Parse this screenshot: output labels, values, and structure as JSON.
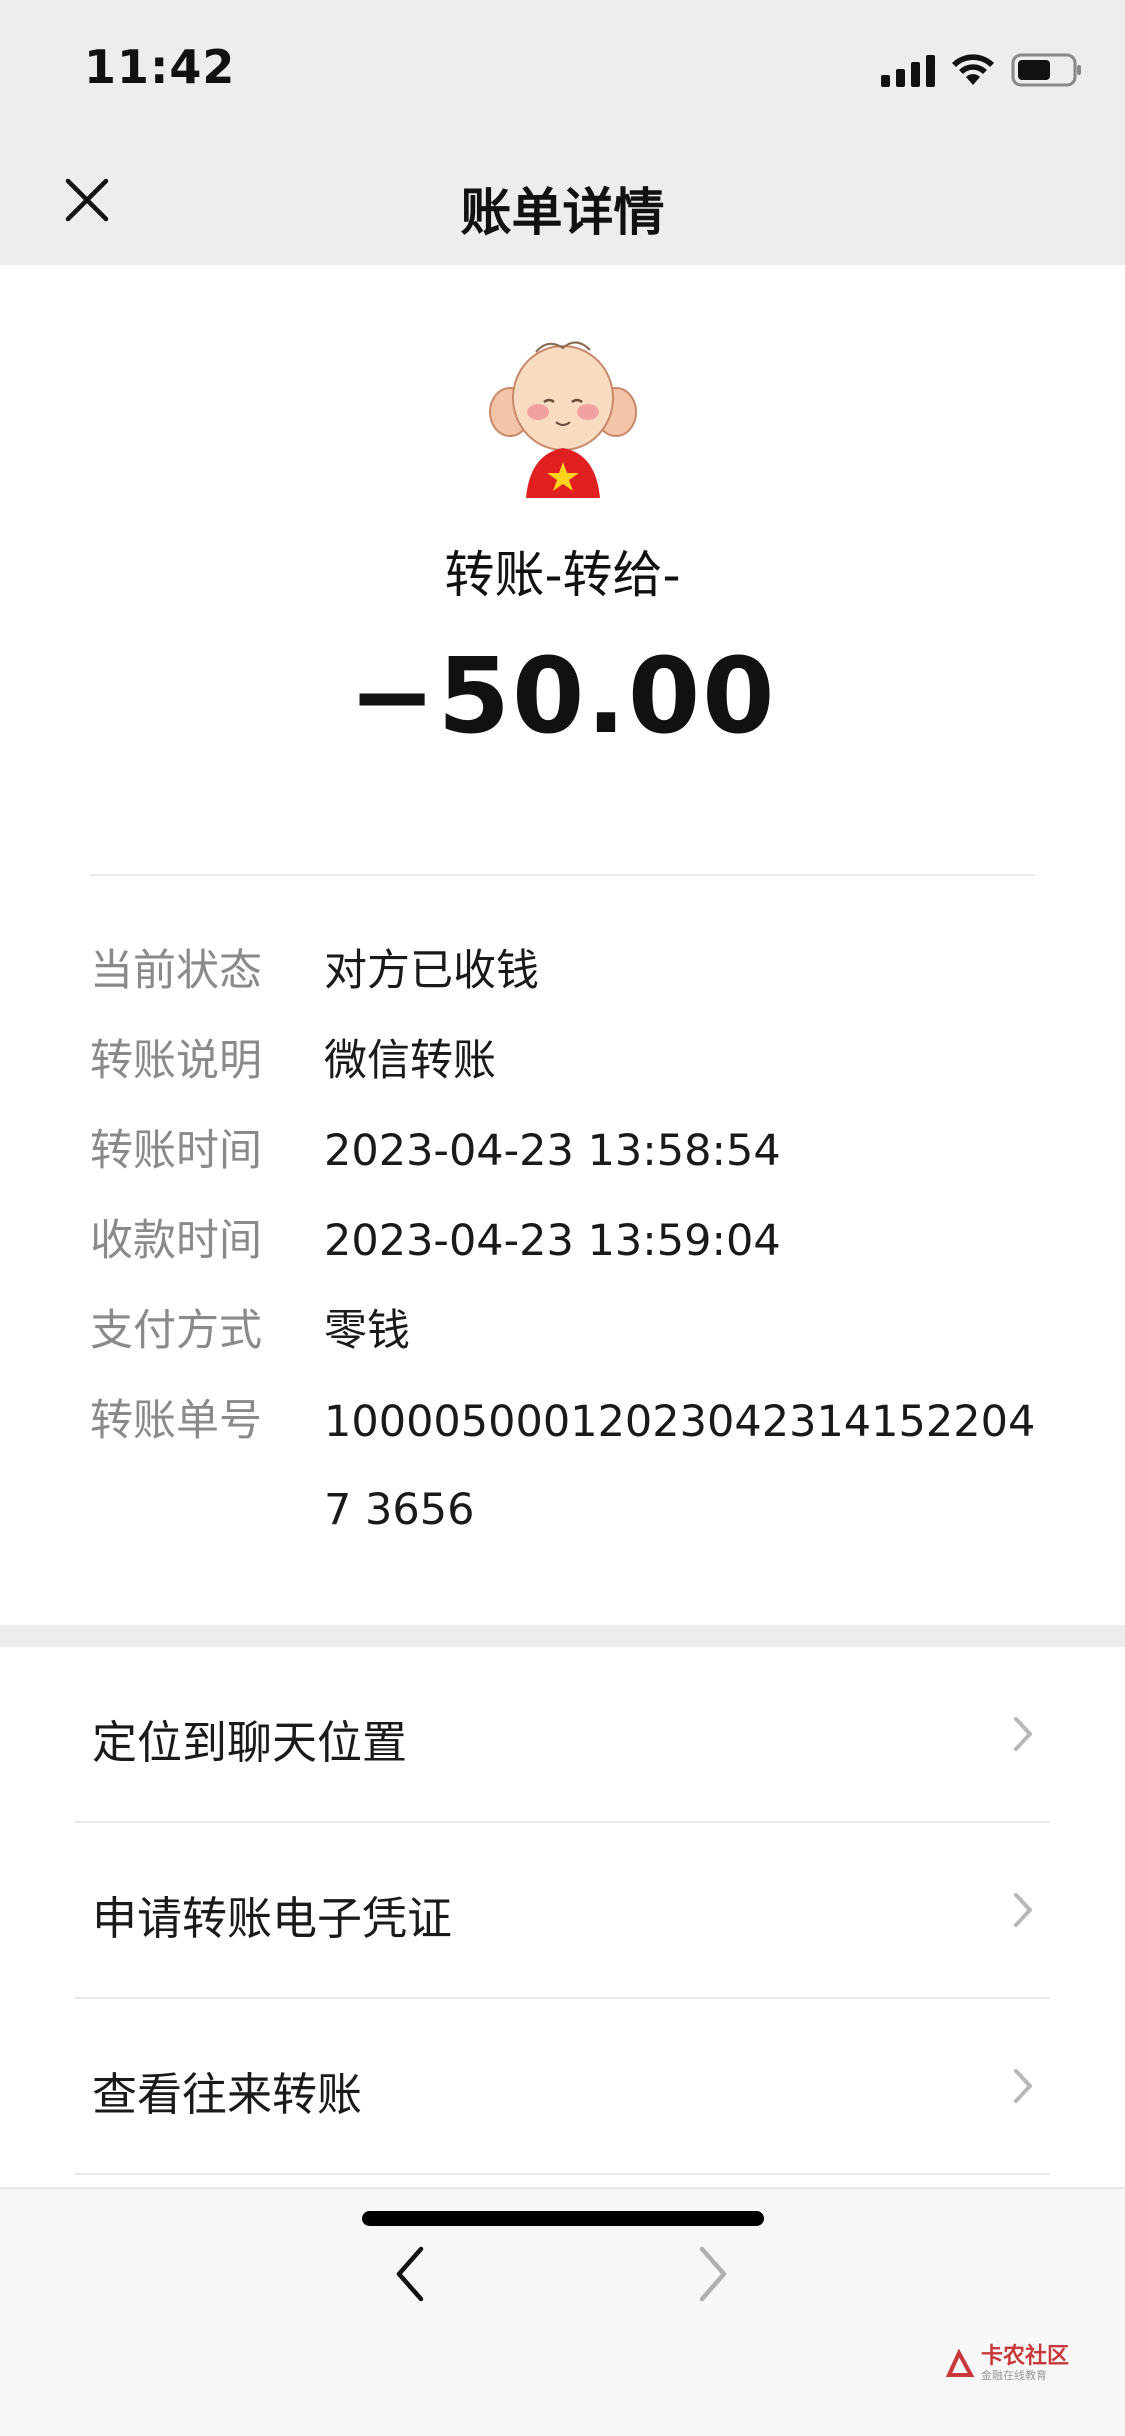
{
  "status_bar": {
    "time": "11:42",
    "icons": [
      "cellular-signal-icon",
      "wifi-icon",
      "battery-icon"
    ]
  },
  "nav": {
    "title": "账单详情",
    "close_icon": "close-icon"
  },
  "transfer": {
    "title": "转账-转给-",
    "amount": "−50.00"
  },
  "details": {
    "rows": [
      {
        "label": "当前状态",
        "value": "对方已收钱"
      },
      {
        "label": "转账说明",
        "value": "微信转账"
      },
      {
        "label": "转账时间",
        "value": "2023-04-23 13:58:54"
      },
      {
        "label": "收款时间",
        "value": "2023-04-23 13:59:04"
      },
      {
        "label": "支付方式",
        "value": "零钱"
      },
      {
        "label": "转账单号",
        "value": "100005000120230423141522047 3656"
      }
    ]
  },
  "actions": {
    "items": [
      {
        "label": "定位到聊天位置"
      },
      {
        "label": "申请转账电子凭证"
      },
      {
        "label": "查看往来转账"
      }
    ]
  },
  "toolbar": {
    "back_icon": "chevron-left-icon",
    "forward_icon": "chevron-right-icon"
  },
  "watermark": {
    "main": "卡农社区",
    "sub": "金融在线教育"
  },
  "colors": {
    "background": "#ededed",
    "card": "#ffffff",
    "label_gray": "#8a8a8a",
    "text": "#1a1a1a",
    "watermark_red": "#c8383a"
  }
}
